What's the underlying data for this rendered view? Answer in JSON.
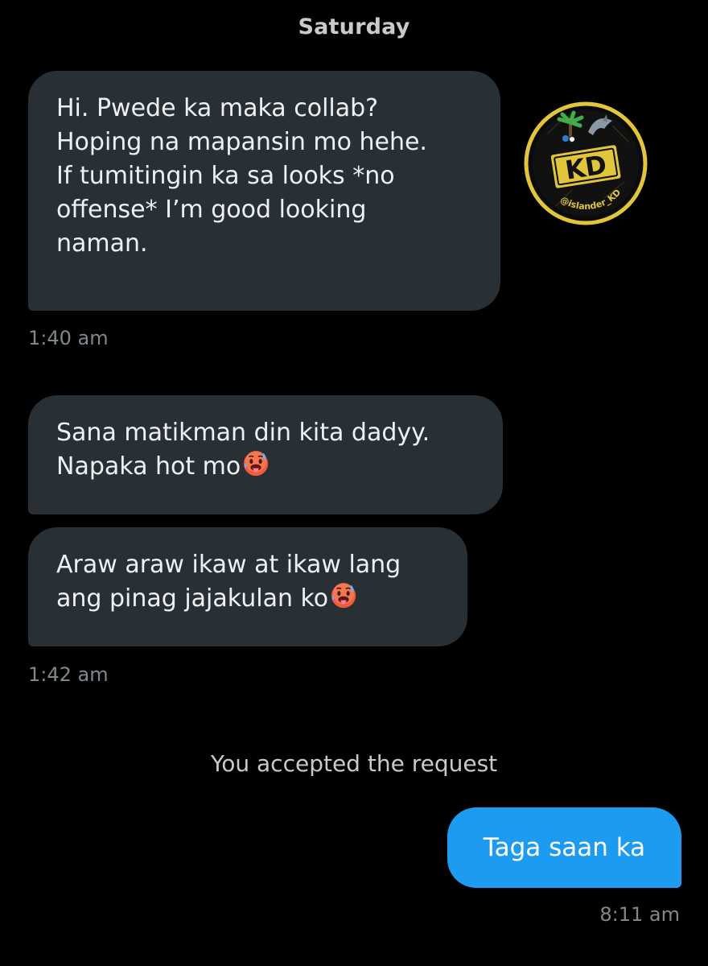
{
  "conversation": {
    "date_header": "Saturday",
    "messages": [
      {
        "text": "Hi. Pwede ka maka collab?\nHoping na mapansin mo hehe.\nIf tumitingin ka sa looks *no\noffense* I’m good looking\nnaman."
      },
      {
        "text": "Sana matikman din kita dadyy.\nNapaka hot mo"
      },
      {
        "text": "Araw araw ikaw at ikaw lang\nang pinag jajakulan ko"
      },
      {
        "text": "Taga saan ka"
      }
    ],
    "timestamps": [
      "1:40 am",
      "1:42 am",
      "8:11 am"
    ],
    "system_message": "You accepted the request"
  },
  "avatar": {
    "logo_text": "KD",
    "handle": "@islander_KD",
    "icon": "kd-logo-avatar"
  },
  "icons": {
    "emoji": "hot-face-emoji"
  },
  "colors": {
    "background": "#000000",
    "incoming_bubble": "#283036",
    "outgoing_bubble": "#1d9bf0",
    "timestamp_text": "#80878c",
    "logo_gold": "#e1c53a"
  }
}
